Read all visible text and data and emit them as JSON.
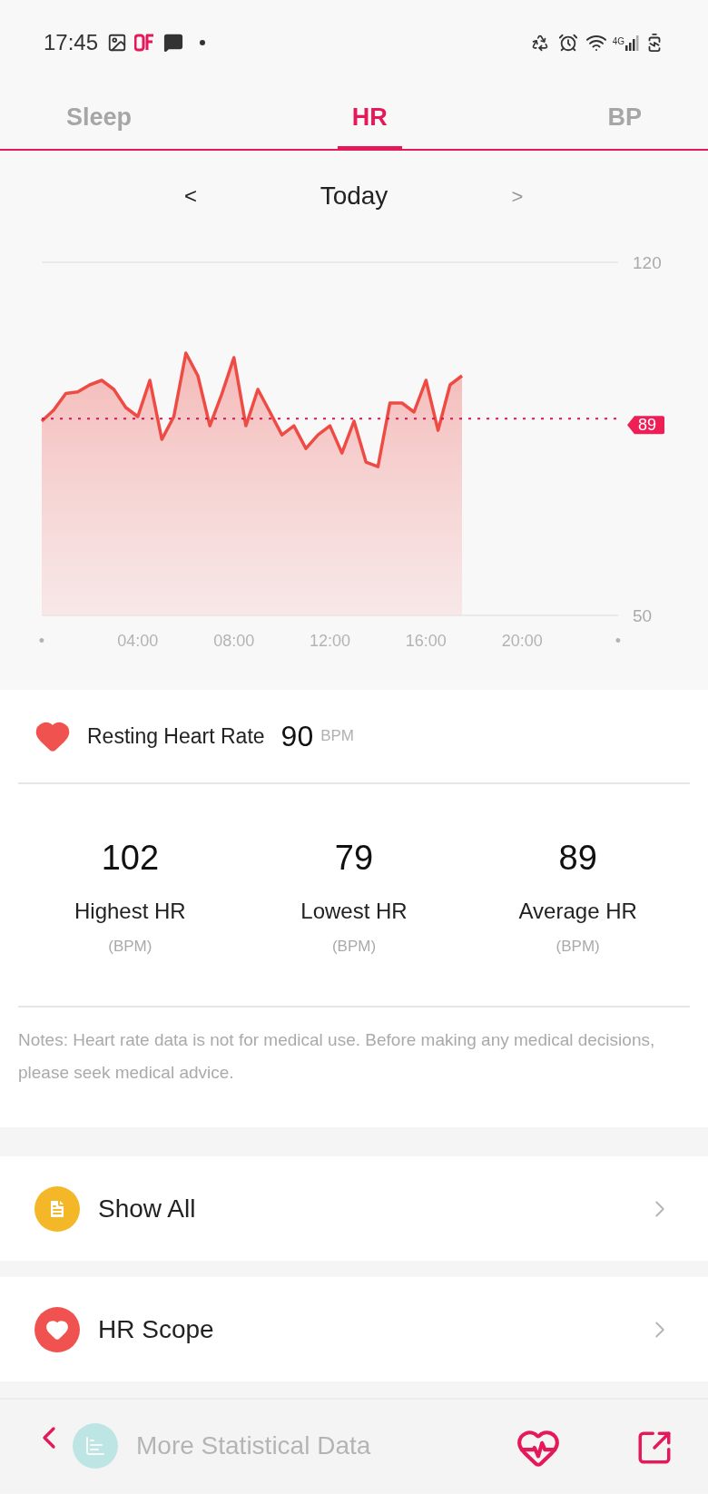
{
  "status_bar": {
    "time": "17:45",
    "network": "4G"
  },
  "tabs": [
    {
      "label": "Sleep",
      "selected": false
    },
    {
      "label": "HR",
      "selected": true
    },
    {
      "label": "BP",
      "selected": false
    }
  ],
  "date_nav": {
    "prev": "<",
    "label": "Today",
    "next": ">"
  },
  "chart": {
    "chart_data": {
      "type": "area",
      "xlim": [
        0,
        24
      ],
      "ylim": [
        50,
        120
      ],
      "yticks": [
        120,
        50
      ],
      "xticks": [
        {
          "value": 0,
          "label": "•"
        },
        {
          "value": 4,
          "label": "04:00"
        },
        {
          "value": 8,
          "label": "08:00"
        },
        {
          "value": 12,
          "label": "12:00"
        },
        {
          "value": 16,
          "label": "16:00"
        },
        {
          "value": 20,
          "label": "20:00"
        },
        {
          "value": 24,
          "label": "•"
        }
      ],
      "x": [
        0,
        0.5,
        1,
        1.5,
        2,
        2.5,
        3,
        3.5,
        4,
        4.5,
        5,
        5.5,
        6,
        6.5,
        7,
        7.5,
        8,
        8.5,
        9,
        9.5,
        10,
        10.5,
        11,
        11.5,
        12,
        12.5,
        13,
        13.5,
        14,
        14.5,
        15,
        15.5,
        16,
        16.5,
        17,
        17.5,
        18,
        18.5,
        19,
        19.5,
        20,
        20.5,
        21,
        21.5,
        22,
        22.5,
        23,
        23.5,
        24
      ],
      "series": [
        {
          "color": "#ef4b45",
          "values": [
            88.5,
            90.7,
            94,
            94.3,
            95.7,
            96.6,
            94.8,
            91.2,
            89.4,
            96.6,
            84.9,
            89.4,
            102,
            97.5,
            87.6,
            93.9,
            101.1,
            87.6,
            94.8,
            90.3,
            85.8,
            87.6,
            83.1,
            85.8,
            87.6,
            82.2,
            88.5,
            80.4,
            79.5,
            92.1,
            92.1,
            90.3,
            96.6,
            86.7,
            95.7,
            97.5,
            null,
            null,
            null,
            null,
            null,
            null,
            null,
            null,
            null,
            null,
            null,
            null,
            null
          ]
        },
        {
          "type": "line",
          "line_style": "dotted",
          "color": "#d6174f",
          "values": [
            89,
            89,
            89,
            89,
            89,
            89,
            89,
            89,
            89,
            89,
            89,
            89,
            89,
            89,
            89,
            89,
            89,
            89,
            89,
            89,
            89,
            89,
            89,
            89,
            89,
            89,
            89,
            89,
            89,
            89,
            89,
            89,
            89,
            89,
            89,
            89,
            89,
            89,
            89,
            89,
            89,
            89,
            89,
            89,
            89,
            89,
            89,
            89,
            89
          ]
        }
      ]
    },
    "average_badge": "89"
  },
  "resting": {
    "label": "Resting Heart Rate",
    "value": "90",
    "unit": "BPM"
  },
  "stats": [
    {
      "value": "102",
      "label": "Highest HR",
      "unit": "(BPM)"
    },
    {
      "value": "79",
      "label": "Lowest HR",
      "unit": "(BPM)"
    },
    {
      "value": "89",
      "label": "Average HR",
      "unit": "(BPM)"
    }
  ],
  "notes": "Notes: Heart rate data is not for medical use. Before making any medical decisions, please seek medical advice.",
  "menu": [
    {
      "label": "Show All",
      "kind": "records"
    },
    {
      "label": "HR Scope",
      "kind": "scope"
    },
    {
      "label": "More Statistical Data",
      "kind": "stats"
    }
  ]
}
